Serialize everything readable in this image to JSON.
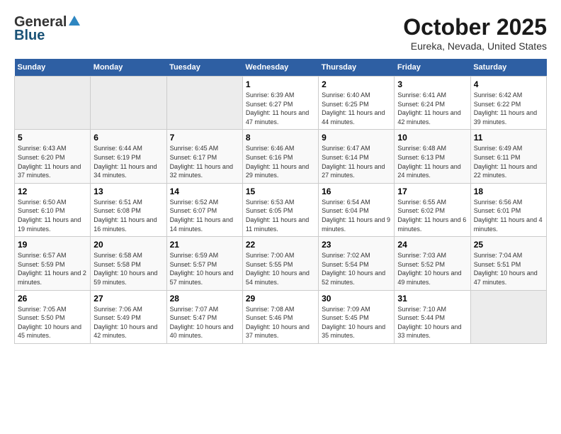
{
  "header": {
    "logo_general": "General",
    "logo_blue": "Blue",
    "title": "October 2025",
    "location": "Eureka, Nevada, United States"
  },
  "days_of_week": [
    "Sunday",
    "Monday",
    "Tuesday",
    "Wednesday",
    "Thursday",
    "Friday",
    "Saturday"
  ],
  "weeks": [
    [
      {
        "day": "",
        "empty": true
      },
      {
        "day": "",
        "empty": true
      },
      {
        "day": "",
        "empty": true
      },
      {
        "day": "1",
        "sunrise": "6:39 AM",
        "sunset": "6:27 PM",
        "daylight": "11 hours and 47 minutes."
      },
      {
        "day": "2",
        "sunrise": "6:40 AM",
        "sunset": "6:25 PM",
        "daylight": "11 hours and 44 minutes."
      },
      {
        "day": "3",
        "sunrise": "6:41 AM",
        "sunset": "6:24 PM",
        "daylight": "11 hours and 42 minutes."
      },
      {
        "day": "4",
        "sunrise": "6:42 AM",
        "sunset": "6:22 PM",
        "daylight": "11 hours and 39 minutes."
      }
    ],
    [
      {
        "day": "5",
        "sunrise": "6:43 AM",
        "sunset": "6:20 PM",
        "daylight": "11 hours and 37 minutes."
      },
      {
        "day": "6",
        "sunrise": "6:44 AM",
        "sunset": "6:19 PM",
        "daylight": "11 hours and 34 minutes."
      },
      {
        "day": "7",
        "sunrise": "6:45 AM",
        "sunset": "6:17 PM",
        "daylight": "11 hours and 32 minutes."
      },
      {
        "day": "8",
        "sunrise": "6:46 AM",
        "sunset": "6:16 PM",
        "daylight": "11 hours and 29 minutes."
      },
      {
        "day": "9",
        "sunrise": "6:47 AM",
        "sunset": "6:14 PM",
        "daylight": "11 hours and 27 minutes."
      },
      {
        "day": "10",
        "sunrise": "6:48 AM",
        "sunset": "6:13 PM",
        "daylight": "11 hours and 24 minutes."
      },
      {
        "day": "11",
        "sunrise": "6:49 AM",
        "sunset": "6:11 PM",
        "daylight": "11 hours and 22 minutes."
      }
    ],
    [
      {
        "day": "12",
        "sunrise": "6:50 AM",
        "sunset": "6:10 PM",
        "daylight": "11 hours and 19 minutes."
      },
      {
        "day": "13",
        "sunrise": "6:51 AM",
        "sunset": "6:08 PM",
        "daylight": "11 hours and 16 minutes."
      },
      {
        "day": "14",
        "sunrise": "6:52 AM",
        "sunset": "6:07 PM",
        "daylight": "11 hours and 14 minutes."
      },
      {
        "day": "15",
        "sunrise": "6:53 AM",
        "sunset": "6:05 PM",
        "daylight": "11 hours and 11 minutes."
      },
      {
        "day": "16",
        "sunrise": "6:54 AM",
        "sunset": "6:04 PM",
        "daylight": "11 hours and 9 minutes."
      },
      {
        "day": "17",
        "sunrise": "6:55 AM",
        "sunset": "6:02 PM",
        "daylight": "11 hours and 6 minutes."
      },
      {
        "day": "18",
        "sunrise": "6:56 AM",
        "sunset": "6:01 PM",
        "daylight": "11 hours and 4 minutes."
      }
    ],
    [
      {
        "day": "19",
        "sunrise": "6:57 AM",
        "sunset": "5:59 PM",
        "daylight": "11 hours and 2 minutes."
      },
      {
        "day": "20",
        "sunrise": "6:58 AM",
        "sunset": "5:58 PM",
        "daylight": "10 hours and 59 minutes."
      },
      {
        "day": "21",
        "sunrise": "6:59 AM",
        "sunset": "5:57 PM",
        "daylight": "10 hours and 57 minutes."
      },
      {
        "day": "22",
        "sunrise": "7:00 AM",
        "sunset": "5:55 PM",
        "daylight": "10 hours and 54 minutes."
      },
      {
        "day": "23",
        "sunrise": "7:02 AM",
        "sunset": "5:54 PM",
        "daylight": "10 hours and 52 minutes."
      },
      {
        "day": "24",
        "sunrise": "7:03 AM",
        "sunset": "5:52 PM",
        "daylight": "10 hours and 49 minutes."
      },
      {
        "day": "25",
        "sunrise": "7:04 AM",
        "sunset": "5:51 PM",
        "daylight": "10 hours and 47 minutes."
      }
    ],
    [
      {
        "day": "26",
        "sunrise": "7:05 AM",
        "sunset": "5:50 PM",
        "daylight": "10 hours and 45 minutes."
      },
      {
        "day": "27",
        "sunrise": "7:06 AM",
        "sunset": "5:49 PM",
        "daylight": "10 hours and 42 minutes."
      },
      {
        "day": "28",
        "sunrise": "7:07 AM",
        "sunset": "5:47 PM",
        "daylight": "10 hours and 40 minutes."
      },
      {
        "day": "29",
        "sunrise": "7:08 AM",
        "sunset": "5:46 PM",
        "daylight": "10 hours and 37 minutes."
      },
      {
        "day": "30",
        "sunrise": "7:09 AM",
        "sunset": "5:45 PM",
        "daylight": "10 hours and 35 minutes."
      },
      {
        "day": "31",
        "sunrise": "7:10 AM",
        "sunset": "5:44 PM",
        "daylight": "10 hours and 33 minutes."
      },
      {
        "day": "",
        "empty": true
      }
    ]
  ],
  "labels": {
    "sunrise_prefix": "Sunrise: ",
    "sunset_prefix": "Sunset: ",
    "daylight_prefix": "Daylight: "
  }
}
